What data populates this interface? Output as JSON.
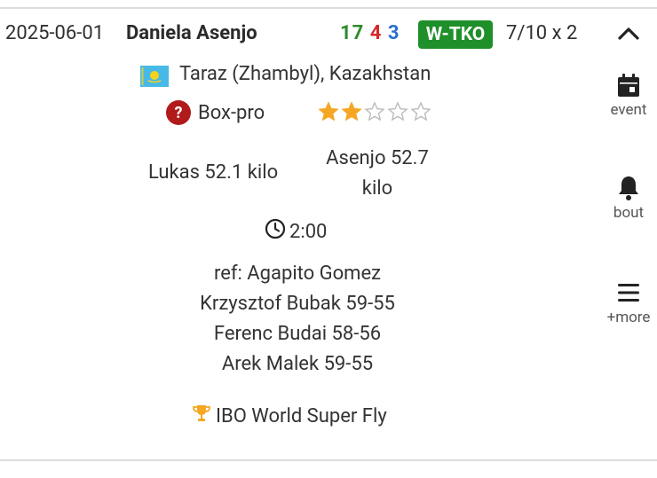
{
  "header": {
    "date": "2025-06-01",
    "fighter": "Daniela Asenjo",
    "record": {
      "wins": "17",
      "losses": "4",
      "draws": "3"
    },
    "result": "W-TKO",
    "rounds": "7/10 x 2",
    "collapse_icon": "chevron-up-icon"
  },
  "details": {
    "location": "Taraz (Zhambyl), Kazakhstan",
    "flag_icon": "kazakhstan-flag-icon",
    "category": "Box-pro",
    "rating_stars": 2,
    "rating_max": 5,
    "weights": {
      "opponent": "Lukas 52.1 kilo",
      "fighter": "Asenjo 52.7 kilo"
    },
    "time": "2:00",
    "referee": "ref: Agapito Gomez",
    "judges": [
      "Krzysztof Bubak 59-55",
      "Ferenc Budai 58-56",
      "Arek Malek 59-55"
    ],
    "title": "IBO World Super Fly"
  },
  "sidebar": {
    "event_label": "event",
    "bout_label": "bout",
    "more_label": "+more"
  },
  "colors": {
    "win": "#2e8b2e",
    "loss": "#d42a2a",
    "draw": "#2b6fcf",
    "badge": "#1f8f2a",
    "star": "#f5a623"
  }
}
